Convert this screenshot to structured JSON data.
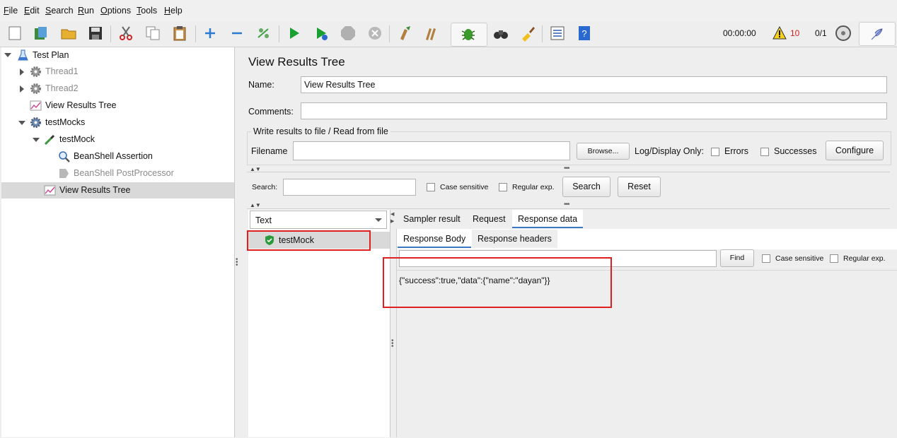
{
  "menu": [
    "File",
    "Edit",
    "Search",
    "Run",
    "Options",
    "Tools",
    "Help"
  ],
  "menu_mnemonic": [
    "F",
    "E",
    "S",
    "R",
    "O",
    "T",
    "H"
  ],
  "menu_rest": [
    "ile",
    "dit",
    "earch",
    "un",
    "ptions",
    "ools",
    "elp"
  ],
  "toolbar": {
    "timer": "00:00:00",
    "warning_count": "10",
    "threads": "0/1"
  },
  "tree": {
    "items": [
      {
        "label": "Test Plan"
      },
      {
        "label": "Thread1"
      },
      {
        "label": "Thread2"
      },
      {
        "label": "View Results Tree"
      },
      {
        "label": "testMocks"
      },
      {
        "label": "testMock"
      },
      {
        "label": "BeanShell Assertion"
      },
      {
        "label": "BeanShell PostProcessor"
      },
      {
        "label": "View Results Tree"
      }
    ]
  },
  "panel": {
    "title": "View Results Tree",
    "name_label": "Name:",
    "name_value": "View Results Tree",
    "comments_label": "Comments:",
    "comments_value": "",
    "file_section": "Write results to file / Read from file",
    "filename_label": "Filename",
    "filename_value": "",
    "browse": "Browse...",
    "log_display": "Log/Display Only:",
    "errors": "Errors",
    "successes": "Successes",
    "configure": "Configure",
    "search_label": "Search:",
    "search_value": "",
    "case_sensitive": "Case sensitive",
    "regular_exp": "Regular exp.",
    "search_btn": "Search",
    "reset_btn": "Reset",
    "renderer": "Text",
    "result_item": "testMock",
    "tabs": [
      "Sampler result",
      "Request",
      "Response data"
    ],
    "subtabs": [
      "Response Body",
      "Response headers"
    ],
    "find_btn": "Find",
    "find_case": "Case sensitive",
    "find_regex": "Regular exp.",
    "find_value": "",
    "response_body": "{\"success\":true,\"data\":{\"name\":\"dayan\"}}"
  },
  "colors": {
    "accent": "#3a78c5",
    "highlight": "#e02020",
    "warning": "#d02020",
    "selected_row": "#d9d9d9"
  }
}
